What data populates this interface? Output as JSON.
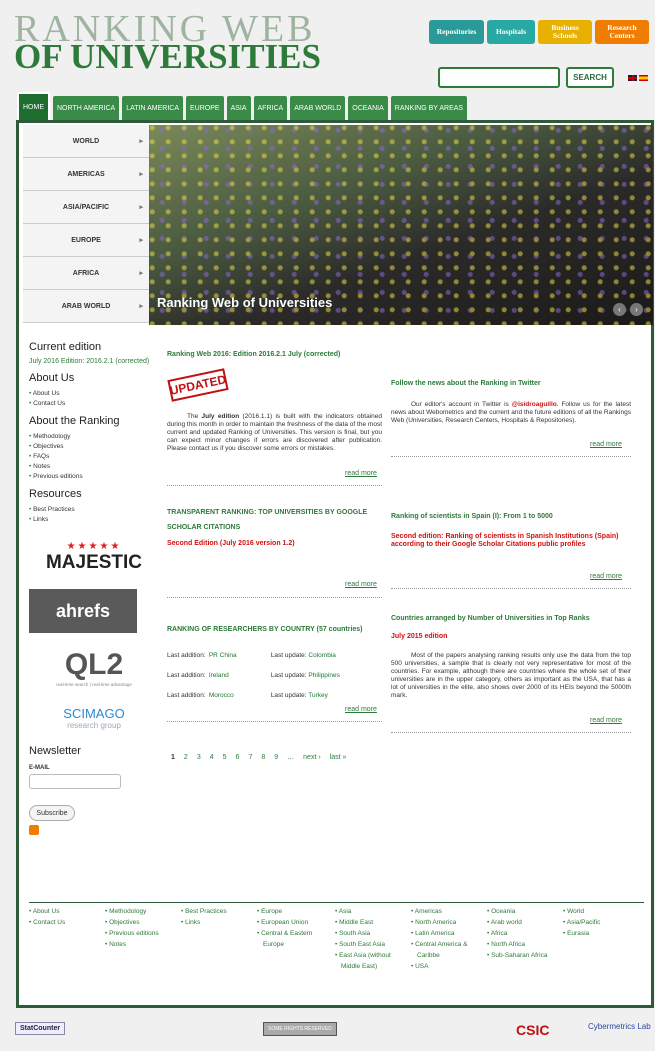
{
  "logo": {
    "line1": "RANKING WEB",
    "line2": "OF UNIVERSITIES"
  },
  "topbtns": [
    "Repositories",
    "Hospitals",
    "Business Schools",
    "Research Centers"
  ],
  "search_label": "SEARCH",
  "nav": [
    "HOME",
    "NORTH AMERICA",
    "LATIN AMERICA",
    "EUROPE",
    "ASIA",
    "AFRICA",
    "ARAB WORLD",
    "OCEANIA",
    "RANKING BY AREAS"
  ],
  "menu": [
    "WORLD",
    "AMERICAS",
    "ASIA/PACIFIC",
    "EUROPE",
    "AFRICA",
    "ARAB WORLD"
  ],
  "hero_caption": "Ranking Web of Universities",
  "side": {
    "current_h": "Current edition",
    "current_text": "July 2016 Edition: 2016.2.1 (corrected)",
    "about_h": "About Us",
    "about": [
      "About Us",
      "Contact Us"
    ],
    "rank_h": "About the Ranking",
    "rank": [
      "Methodology",
      "Objectives",
      "FAQs",
      "Notes",
      "Previous editions"
    ],
    "res_h": "Resources",
    "res": [
      "Best Practices",
      "Links"
    ],
    "news_h": "Newsletter",
    "email_label": "E-MAIL",
    "subscribe": "Subscribe"
  },
  "sponsors": [
    "MAJESTIC",
    "ahrefs",
    "QL2",
    "real-time search | real-time advantage",
    "SCIMAGO",
    "research group"
  ],
  "main": {
    "headline": "Ranking Web 2016: Edition 2016.2.1 July (corrected)",
    "updated": "UPDATED",
    "p1a": "The ",
    "p1b": "July edition",
    "p1c": " (2016.1.1) is built with the indicators obtained during this month in order to maintain the freshness of the data of the most current and updated Ranking of Universities. This version is final, but you can expect minor changes if errors are discovered after publication. Please contact us if you discover some errors or mistakes.",
    "follow_h": "Follow the news about the Ranking in Twitter",
    "follow_a": "Our editor's account in Twitter is ",
    "follow_handle": "@isidroaguillo",
    "follow_b": ". Follow us for the latest news about Webometrics and the current and the future editions of all the Rankings Web (Universities, Research Centers, Hospitals & Repositories).",
    "read_more": "read more",
    "transp_h": "TRANSPARENT RANKING: TOP UNIVERSITIES BY GOOGLE SCHOLAR CITATIONS",
    "transp_r": "Second Edition (July 2016 version 1.2)",
    "sci_h": "Ranking of scientists in Spain (I): From 1 to 5000",
    "sci_r": "Second edition: Ranking of scientists in Spanish Institutions (Spain) according to their Google Scholar Citations public profiles",
    "res_h": "RANKING OF RESEARCHERS BY COUNTRY (57 countries)",
    "res_rows": [
      [
        "Last addition:",
        "PR China",
        "Last update:",
        "Colombia"
      ],
      [
        "Last addition:",
        "Ireland",
        "Last update:",
        "Philippines"
      ],
      [
        "Last addition:",
        "Morocco",
        "Last update:",
        "Turkey"
      ]
    ],
    "count_h": "Countries arranged by Number of Universities in Top Ranks",
    "count_r": "July 2015 edition",
    "count_p": "Most of the papers analysing ranking results only use the data from the top 500 universities, a sample that is clearly not very representative for most of the countries. For example, although there are countries where the whole set of their universities are in the upper category, others as important as the USA, that has a lot of universities in the elite, also shows over 2000 of its HEIs beyond the 5000th mark.",
    "pages": [
      "1",
      "2",
      "3",
      "4",
      "5",
      "6",
      "7",
      "8",
      "9",
      "…",
      "next ›",
      "last »"
    ]
  },
  "footer": [
    [
      "About Us",
      "Contact Us"
    ],
    [
      "Methodology",
      "Objectives",
      "Previous editions",
      "Notes"
    ],
    [
      "Best Practices",
      "Links"
    ],
    [
      "Europe",
      "European Union",
      "Central & Eastern Europe"
    ],
    [
      "Asia",
      "Middle East",
      "South Asia",
      "South East Asia",
      "East Asia (without Middle East)"
    ],
    [
      "Americas",
      "North America",
      "Latin America",
      "Central America & Caribbe",
      "USA"
    ],
    [
      "Oceania",
      "Arab world",
      "Africa",
      "North Africa",
      "Sub-Saharan Africa"
    ],
    [
      "World",
      "Asia/Pacific",
      "Eurasia"
    ]
  ],
  "bottom": {
    "statcounter": "StatCounter",
    "cc": "SOME RIGHTS RESERVED",
    "csic": "CSIC",
    "cyber": "Cybermetrics Lab"
  }
}
